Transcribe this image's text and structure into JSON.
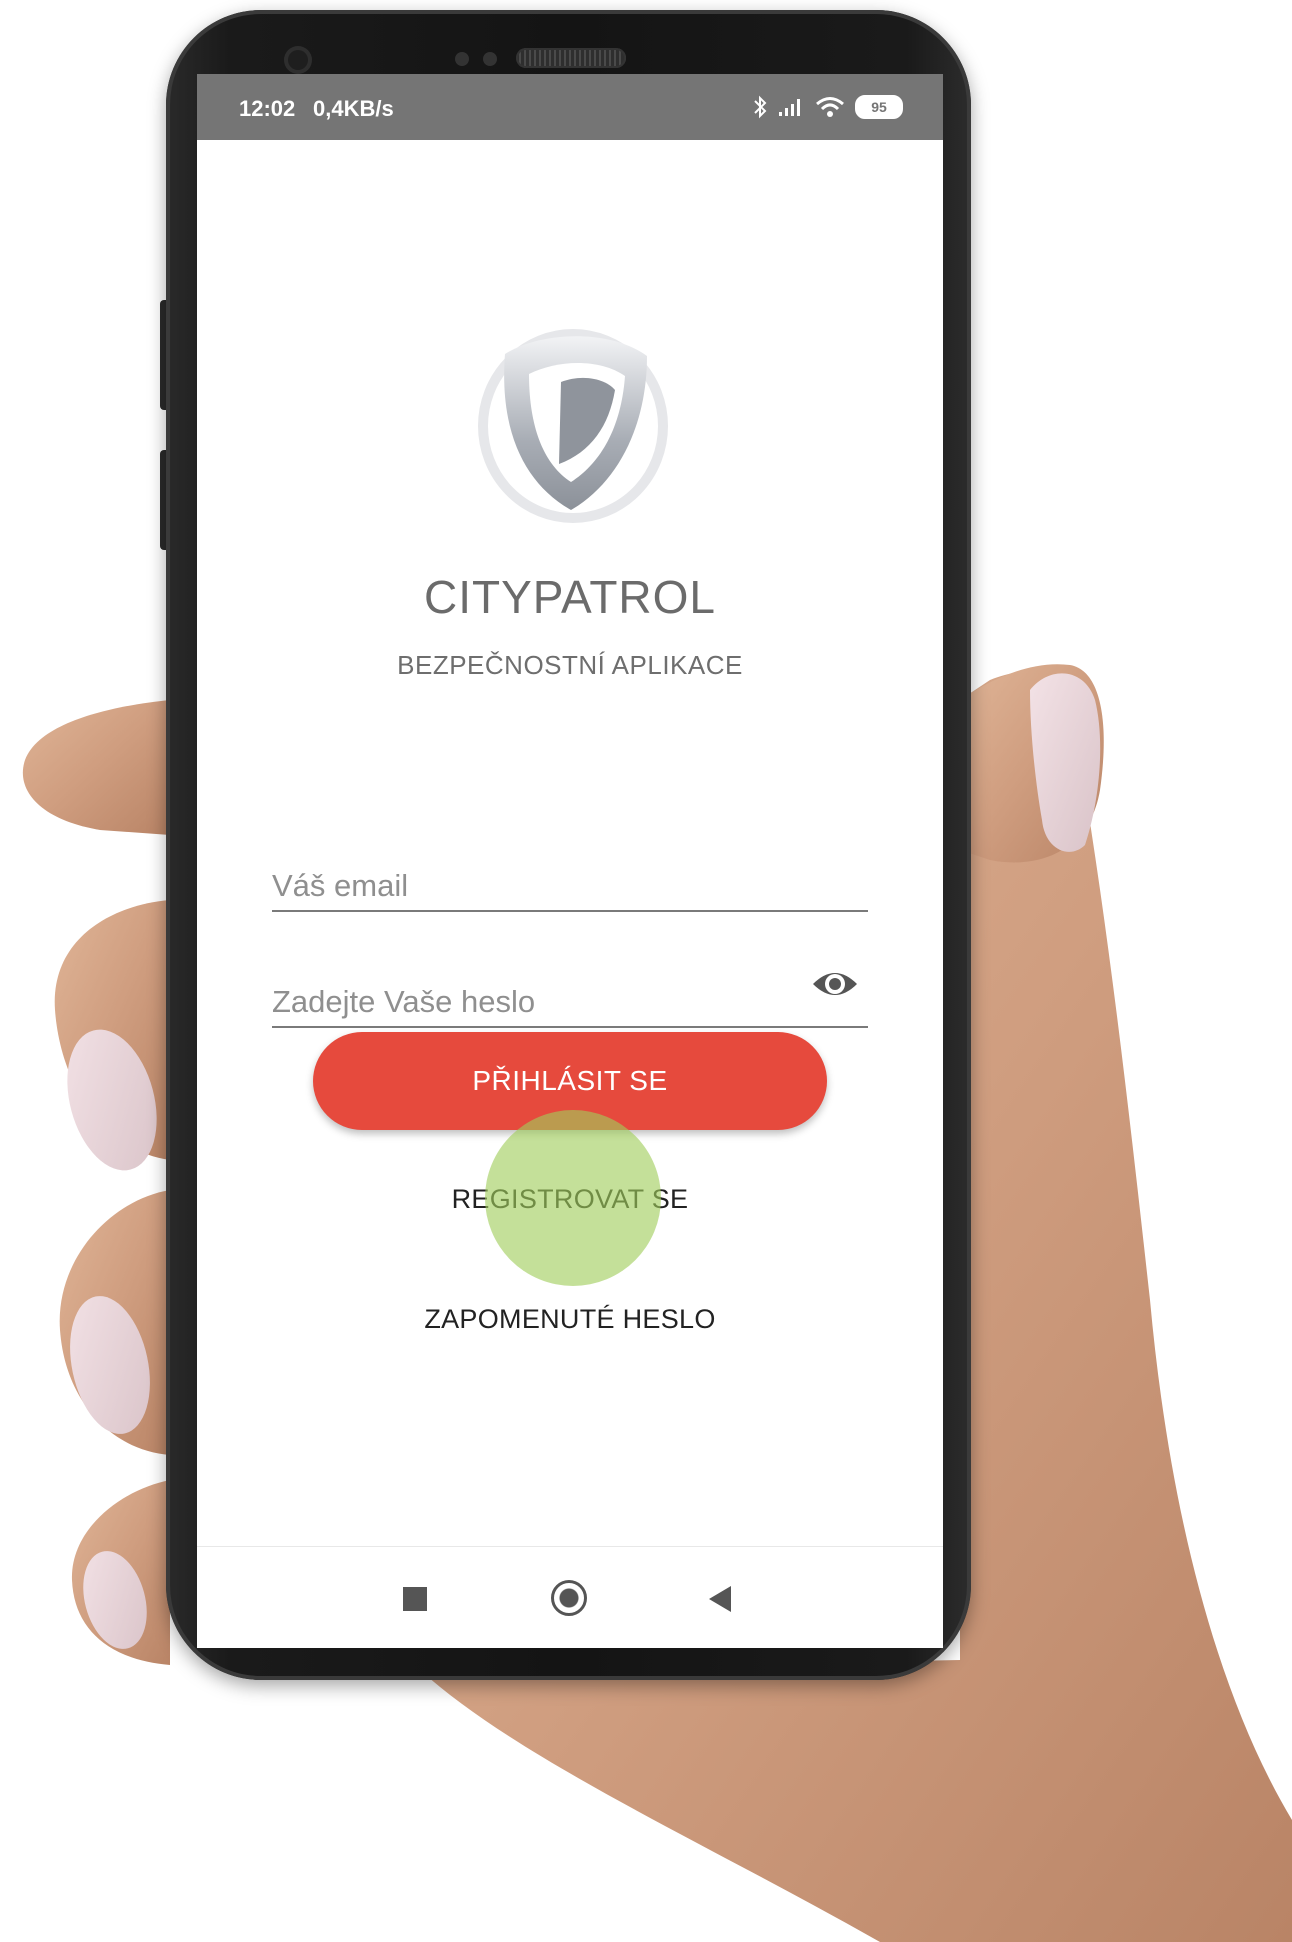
{
  "status_bar": {
    "time": "12:02",
    "network_speed": "0,4KB/s",
    "battery_level": "95",
    "icons": [
      "bluetooth-icon",
      "signal-icon",
      "wifi-icon",
      "battery-icon"
    ]
  },
  "app": {
    "logo_icon": "shield-logo-icon",
    "title": "CITYPATROL",
    "subtitle": "BEZPEČNOSTNÍ APLIKACE"
  },
  "form": {
    "email": {
      "value": "",
      "placeholder": "Váš email"
    },
    "password": {
      "value": "",
      "placeholder": "Zadejte Vaše heslo",
      "toggle_icon": "eye-icon"
    }
  },
  "actions": {
    "login_label": "PŘIHLÁSIT SE",
    "register_label": "REGISTROVAT SE",
    "forgot_label": "ZAPOMENUTÉ HESLO"
  },
  "nav": {
    "recents_icon": "square-recents-icon",
    "home_icon": "circle-home-icon",
    "back_icon": "triangle-back-icon"
  },
  "colors": {
    "accent": "#e64a3d",
    "status_bar": "#757575",
    "touch_indicator": "#a0cd5a"
  }
}
